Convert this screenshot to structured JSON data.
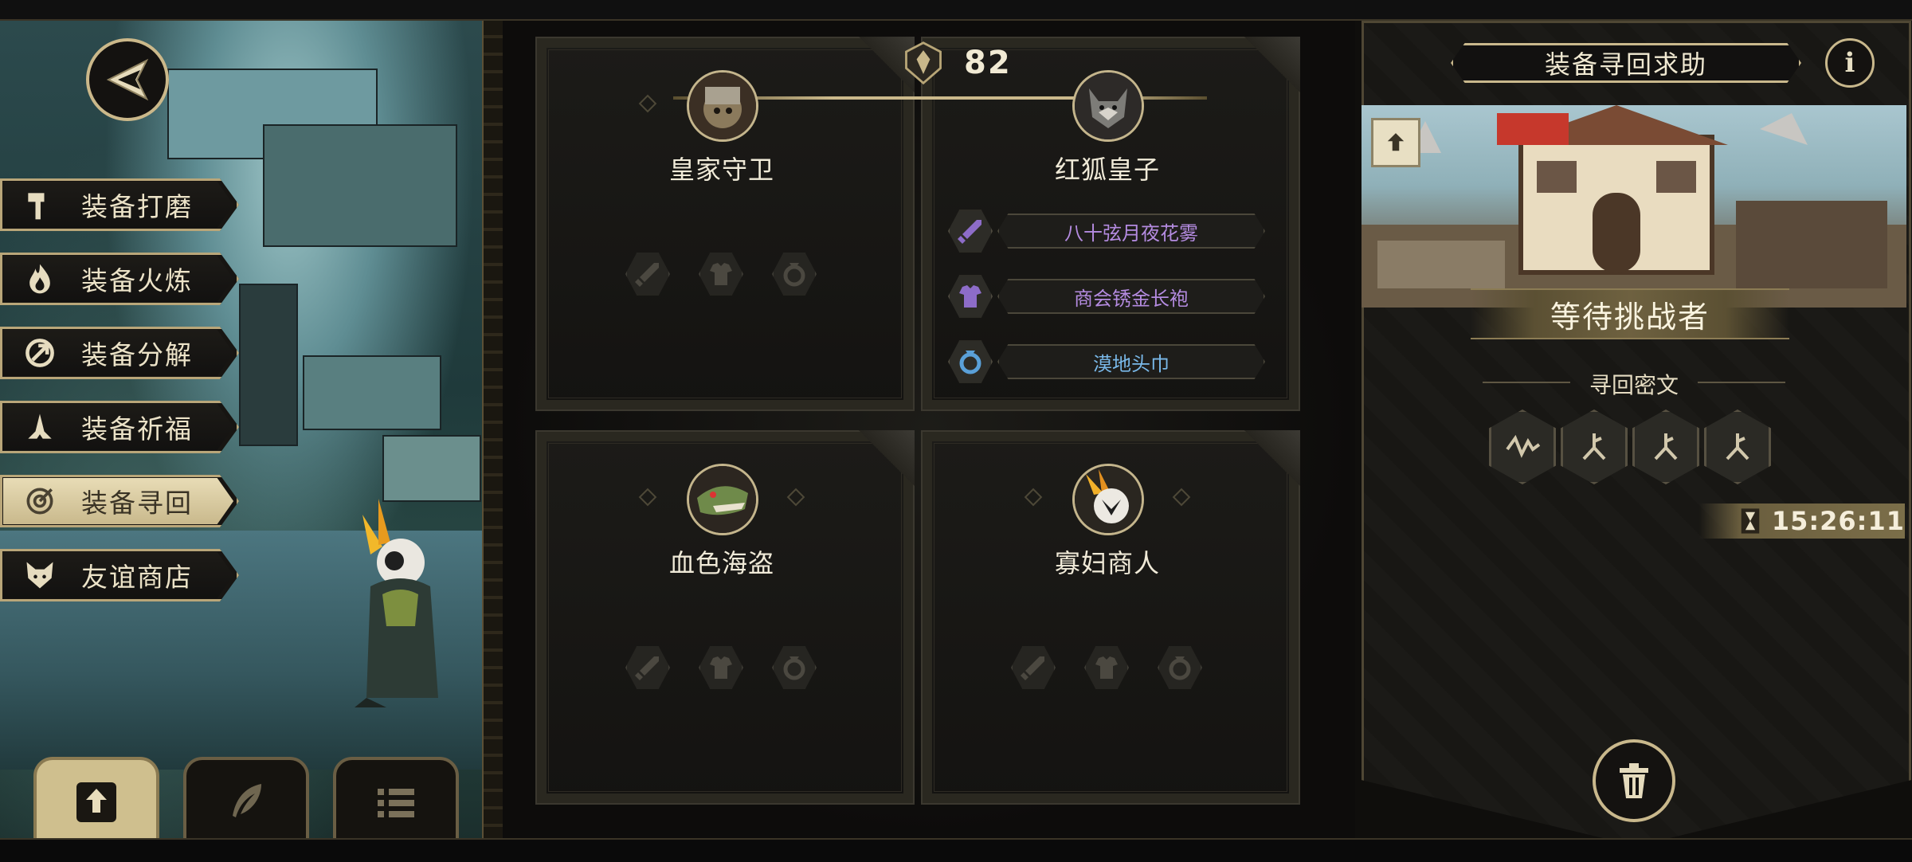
{
  "menu": {
    "items": [
      {
        "label": "装备打磨",
        "icon": "hammer-icon"
      },
      {
        "label": "装备火炼",
        "icon": "flame-icon"
      },
      {
        "label": "装备分解",
        "icon": "disassemble-icon"
      },
      {
        "label": "装备祈福",
        "icon": "pray-icon"
      },
      {
        "label": "装备寻回",
        "icon": "target-icon",
        "active": true
      },
      {
        "label": "友谊商店",
        "icon": "fox-icon"
      }
    ]
  },
  "level": {
    "value": "82"
  },
  "panels": [
    {
      "name": "皇家守卫",
      "avatar": "royal-guard-avatar",
      "equipment": []
    },
    {
      "name": "红狐皇子",
      "avatar": "red-fox-prince-avatar",
      "equipment": [
        {
          "label": "八十弦月夜花雾",
          "icon": "sword-icon",
          "color": "#b48be0"
        },
        {
          "label": "商会锈金长袍",
          "icon": "armor-icon",
          "color": "#b48be0"
        },
        {
          "label": "漠地头巾",
          "icon": "ring-icon",
          "color": "#79b8e8"
        }
      ]
    },
    {
      "name": "血色海盗",
      "avatar": "crimson-pirate-avatar",
      "equipment": []
    },
    {
      "name": "寡妇商人",
      "avatar": "widow-merchant-avatar",
      "equipment": []
    }
  ],
  "right": {
    "title": "装备寻回求助",
    "status": "等待挑战者",
    "cipher_title": "寻回密文",
    "timer": "15:26:11"
  },
  "colors": {
    "gold": "#c9b88c",
    "purple_item": "#b48be0",
    "blue_item": "#79b8e8"
  }
}
